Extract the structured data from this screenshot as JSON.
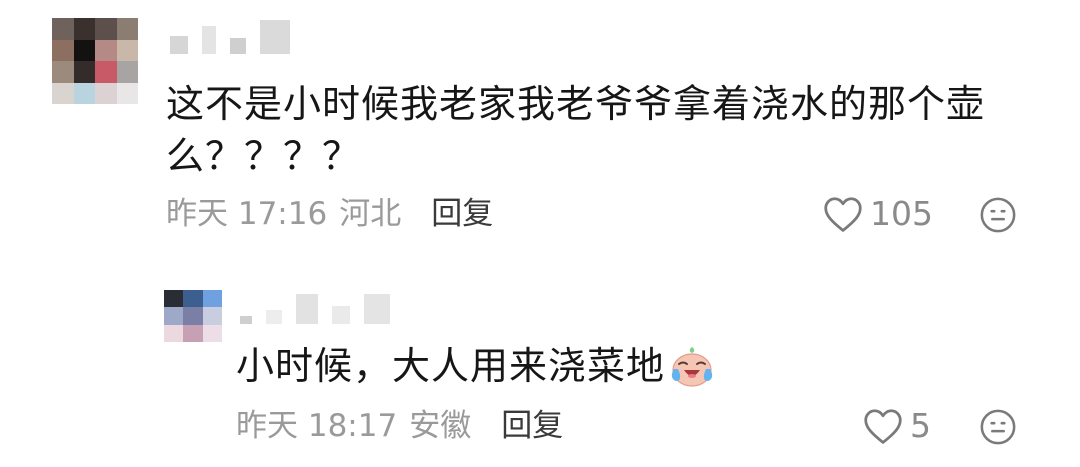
{
  "comments": [
    {
      "id": "main",
      "text": "这不是小时候我老家我老爷爷拿着浇水的那个壶么？？？？",
      "time": "昨天 17:16",
      "location": "河北",
      "reply_label": "回复",
      "likes": "105"
    },
    {
      "id": "reply",
      "text": "小时候，大人用来浇菜地",
      "emoji": "crying-laughing-emoji",
      "time": "昨天 18:17",
      "location": "安徽",
      "reply_label": "回复",
      "likes": "5"
    }
  ],
  "icons": {
    "like": "heart-outline-icon",
    "emoji_button": "smiley-face-icon"
  },
  "colors": {
    "text": "#161616",
    "meta": "#9a9a9a",
    "reply": "#3a3a3a",
    "icon": "#8a8a8a"
  }
}
